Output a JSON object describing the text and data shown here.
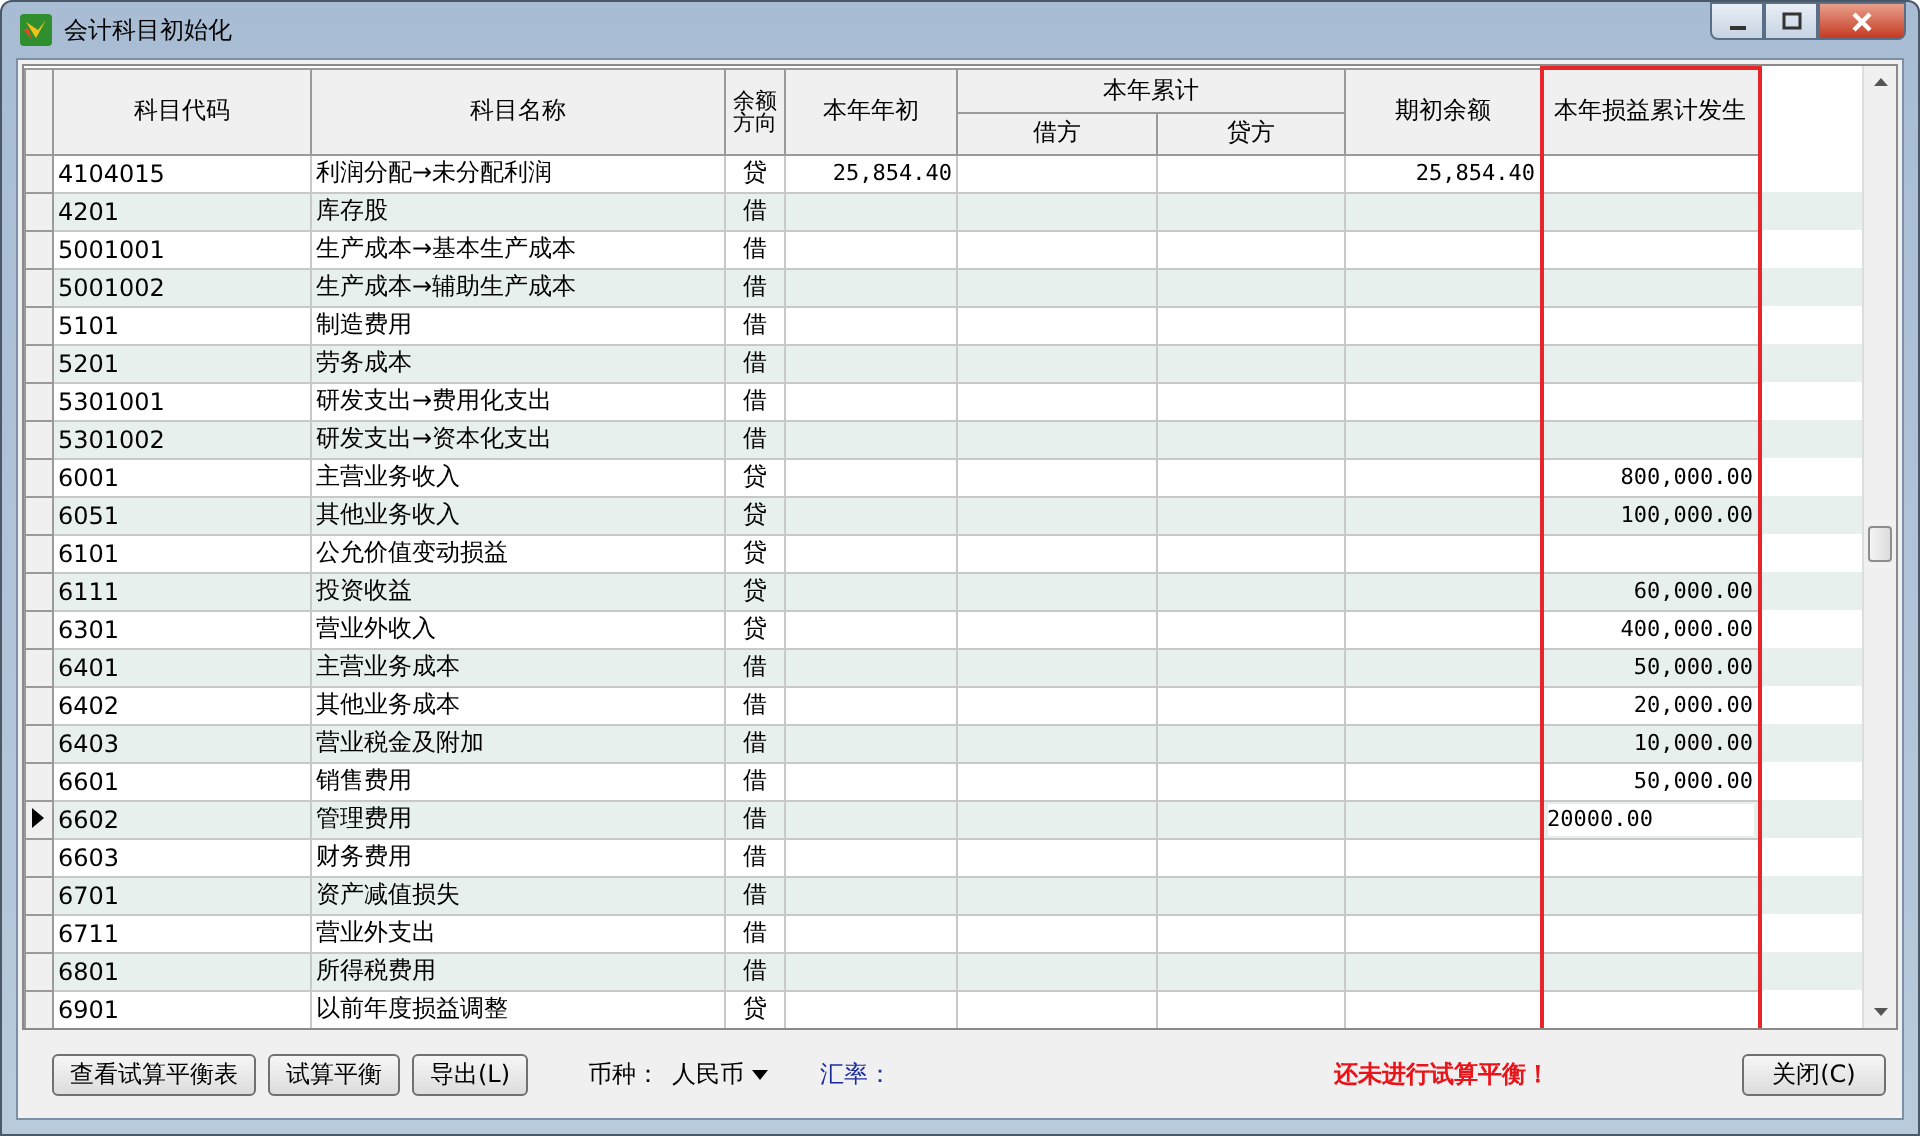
{
  "window": {
    "title": "会计科目初始化"
  },
  "columns": [
    {
      "label": "科目代码",
      "highlighted": false
    },
    {
      "label": "科目名称",
      "highlighted": false
    },
    {
      "label": "余额方向",
      "highlighted": false
    },
    {
      "label": "本年年初",
      "highlighted": false
    },
    {
      "label": "本年累计",
      "highlighted": false,
      "children": [
        {
          "label": "借方"
        },
        {
          "label": "贷方"
        }
      ]
    },
    {
      "label": "期初余额",
      "highlighted": false
    },
    {
      "label": "本年损益累计发生",
      "highlighted": true
    }
  ],
  "rows": [
    {
      "code": "4104015",
      "name": "利润分配→未分配利润",
      "direction": "贷",
      "opening": "25,854.40",
      "debit": "",
      "credit": "",
      "balance": "25,854.40",
      "pl": "",
      "selected": false
    },
    {
      "code": "4201",
      "name": "库存股",
      "direction": "借",
      "opening": "",
      "debit": "",
      "credit": "",
      "balance": "",
      "pl": "",
      "selected": false
    },
    {
      "code": "5001001",
      "name": "生产成本→基本生产成本",
      "direction": "借",
      "opening": "",
      "debit": "",
      "credit": "",
      "balance": "",
      "pl": "",
      "selected": false
    },
    {
      "code": "5001002",
      "name": "生产成本→辅助生产成本",
      "direction": "借",
      "opening": "",
      "debit": "",
      "credit": "",
      "balance": "",
      "pl": "",
      "selected": false
    },
    {
      "code": "5101",
      "name": "制造费用",
      "direction": "借",
      "opening": "",
      "debit": "",
      "credit": "",
      "balance": "",
      "pl": "",
      "selected": false
    },
    {
      "code": "5201",
      "name": "劳务成本",
      "direction": "借",
      "opening": "",
      "debit": "",
      "credit": "",
      "balance": "",
      "pl": "",
      "selected": false
    },
    {
      "code": "5301001",
      "name": "研发支出→费用化支出",
      "direction": "借",
      "opening": "",
      "debit": "",
      "credit": "",
      "balance": "",
      "pl": "",
      "selected": false
    },
    {
      "code": "5301002",
      "name": "研发支出→资本化支出",
      "direction": "借",
      "opening": "",
      "debit": "",
      "credit": "",
      "balance": "",
      "pl": "",
      "selected": false
    },
    {
      "code": "6001",
      "name": "主营业务收入",
      "direction": "贷",
      "opening": "",
      "debit": "",
      "credit": "",
      "balance": "",
      "pl": "800,000.00",
      "selected": false
    },
    {
      "code": "6051",
      "name": "其他业务收入",
      "direction": "贷",
      "opening": "",
      "debit": "",
      "credit": "",
      "balance": "",
      "pl": "100,000.00",
      "selected": false
    },
    {
      "code": "6101",
      "name": "公允价值变动损益",
      "direction": "贷",
      "opening": "",
      "debit": "",
      "credit": "",
      "balance": "",
      "pl": "",
      "selected": false
    },
    {
      "code": "6111",
      "name": "投资收益",
      "direction": "贷",
      "opening": "",
      "debit": "",
      "credit": "",
      "balance": "",
      "pl": "60,000.00",
      "selected": false
    },
    {
      "code": "6301",
      "name": "营业外收入",
      "direction": "贷",
      "opening": "",
      "debit": "",
      "credit": "",
      "balance": "",
      "pl": "400,000.00",
      "selected": false
    },
    {
      "code": "6401",
      "name": "主营业务成本",
      "direction": "借",
      "opening": "",
      "debit": "",
      "credit": "",
      "balance": "",
      "pl": "50,000.00",
      "selected": false
    },
    {
      "code": "6402",
      "name": "其他业务成本",
      "direction": "借",
      "opening": "",
      "debit": "",
      "credit": "",
      "balance": "",
      "pl": "20,000.00",
      "selected": false
    },
    {
      "code": "6403",
      "name": "营业税金及附加",
      "direction": "借",
      "opening": "",
      "debit": "",
      "credit": "",
      "balance": "",
      "pl": "10,000.00",
      "selected": false
    },
    {
      "code": "6601",
      "name": "销售费用",
      "direction": "借",
      "opening": "",
      "debit": "",
      "credit": "",
      "balance": "",
      "pl": "50,000.00",
      "selected": false
    },
    {
      "code": "6602",
      "name": "管理费用",
      "direction": "借",
      "opening": "",
      "debit": "",
      "credit": "",
      "balance": "",
      "pl": "20000.00",
      "selected": true
    },
    {
      "code": "6603",
      "name": "财务费用",
      "direction": "借",
      "opening": "",
      "debit": "",
      "credit": "",
      "balance": "",
      "pl": "",
      "selected": false
    },
    {
      "code": "6701",
      "name": "资产减值损失",
      "direction": "借",
      "opening": "",
      "debit": "",
      "credit": "",
      "balance": "",
      "pl": "",
      "selected": false
    },
    {
      "code": "6711",
      "name": "营业外支出",
      "direction": "借",
      "opening": "",
      "debit": "",
      "credit": "",
      "balance": "",
      "pl": "",
      "selected": false
    },
    {
      "code": "6801",
      "name": "所得税费用",
      "direction": "借",
      "opening": "",
      "debit": "",
      "credit": "",
      "balance": "",
      "pl": "",
      "selected": false
    },
    {
      "code": "6901",
      "name": "以前年度损益调整",
      "direction": "贷",
      "opening": "",
      "debit": "",
      "credit": "",
      "balance": "",
      "pl": "",
      "selected": false
    }
  ],
  "buttons": [
    {
      "label": "查看试算平衡表"
    },
    {
      "label": "试算平衡"
    },
    {
      "label": "导出(L)"
    }
  ],
  "currency": {
    "label": "币种：",
    "value": "人民币"
  },
  "exchange_rate": {
    "label": "汇率："
  },
  "status": "还未进行试算平衡！",
  "close_button": "关闭(C)"
}
